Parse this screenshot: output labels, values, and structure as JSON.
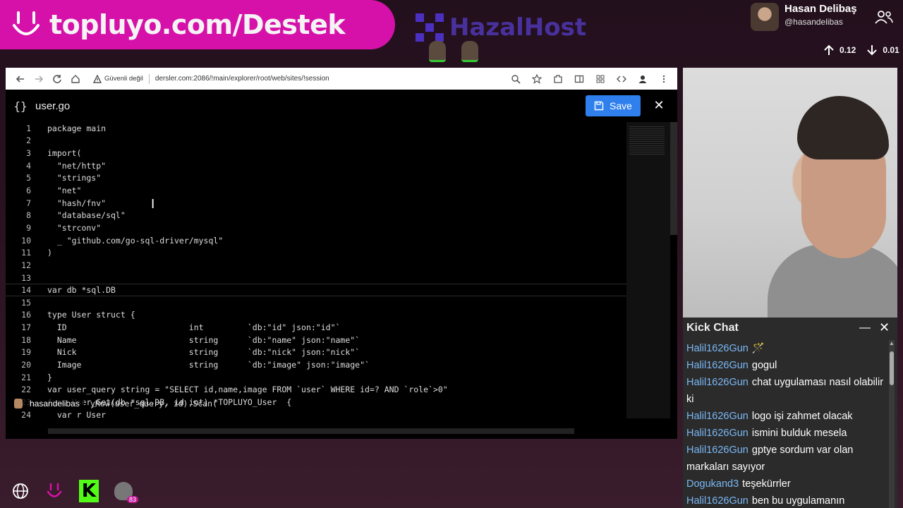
{
  "overlay": {
    "banner_text": "topluyo.com/Destek",
    "host_logo_text": "HazalHost",
    "streamer_name": "Hasan Delibaş",
    "streamer_handle": "@hasandelibas",
    "upload_rate": "0.12",
    "download_rate": "0.01"
  },
  "browser": {
    "security_label": "Güvenli değil",
    "url": "dersler.com:2086/!main/explorer/root/web/sites/!session"
  },
  "editor": {
    "file_name": "user.go",
    "save_label": "Save",
    "close_label": "✕",
    "lines": [
      {
        "n": "1",
        "text": "package main"
      },
      {
        "n": "2",
        "text": ""
      },
      {
        "n": "3",
        "text": "import("
      },
      {
        "n": "4",
        "text": "  \"net/http\""
      },
      {
        "n": "5",
        "text": "  \"strings\""
      },
      {
        "n": "6",
        "text": "  \"net\""
      },
      {
        "n": "7",
        "text": "  \"hash/fnv\""
      },
      {
        "n": "8",
        "text": "  \"database/sql\""
      },
      {
        "n": "9",
        "text": "  \"strconv\""
      },
      {
        "n": "10",
        "text": "  _ \"github.com/go-sql-driver/mysql\""
      },
      {
        "n": "11",
        "text": ")"
      },
      {
        "n": "12",
        "text": ""
      },
      {
        "n": "13",
        "text": ""
      },
      {
        "n": "14",
        "text": "var db *sql.DB"
      },
      {
        "n": "15",
        "text": ""
      },
      {
        "n": "16",
        "text": "type User struct {"
      },
      {
        "n": "17",
        "text": "  ID                         int         `db:\"id\" json:\"id\"`"
      },
      {
        "n": "18",
        "text": "  Name                       string      `db:\"name\" json:\"name\"`"
      },
      {
        "n": "19",
        "text": "  Nick                       string      `db:\"nick\" json:\"nick\"`"
      },
      {
        "n": "20",
        "text": "  Image                      string      `db:\"image\" json:\"image\"`"
      },
      {
        "n": "21",
        "text": "}"
      },
      {
        "n": "22",
        "text": "var user_query string = \"SELECT id,name,image FROM `user` WHERE id=? AND `role`>0\""
      },
      {
        "n": "23",
        "text": "func User_Get(db *sql.DB, id int) *TOPLUYO_User  {"
      },
      {
        "n": "24",
        "text": "  var r User"
      }
    ],
    "toast_user": "hasandelibas",
    "toast_tail": "yRow(user_query, id).Scan("
  },
  "chat": {
    "title": "Kick Chat",
    "messages": [
      {
        "user": "Halil1626Gun",
        "text": "🪄"
      },
      {
        "user": "Halil1626Gun",
        "text": "gogul"
      },
      {
        "user": "Halil1626Gun",
        "text": "chat uygulaması nasıl olabilir ki"
      },
      {
        "user": "Halil1626Gun",
        "text": "logo işi zahmet olacak"
      },
      {
        "user": "Halil1626Gun",
        "text": "ismini bulduk mesela"
      },
      {
        "user": "Halil1626Gun",
        "text": "gptye sordum var olan markaları sayıyor"
      },
      {
        "user": "Dogukand3",
        "text": "teşekürrler"
      },
      {
        "user": "Halil1626Gun",
        "text": "ben bu uygulamanın"
      }
    ]
  },
  "taskbar": {
    "kick_letter": "K",
    "badge_count": "83"
  },
  "colors": {
    "banner": "#d611a9",
    "save_button": "#2f80ed",
    "chat_username": "#7ab8f5",
    "kick_green": "#53fc18"
  }
}
